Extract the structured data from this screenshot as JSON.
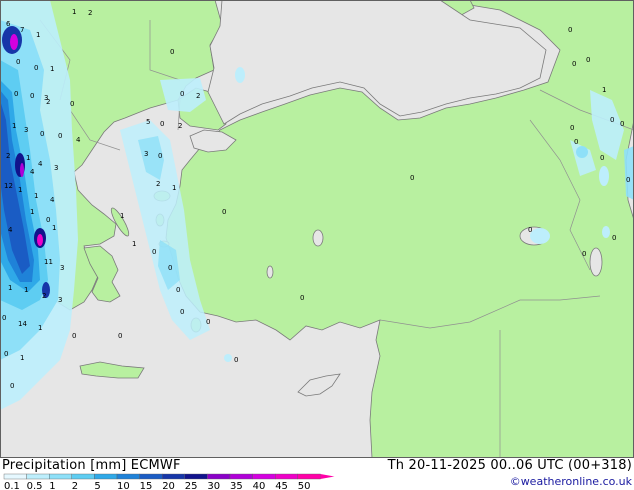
{
  "footer": {
    "title": "Precipitation [mm]  ECMWF",
    "datetime": "Th 20-11-2025 00..06 UTC (00+318)",
    "credit": "©weatheronline.co.uk"
  },
  "legend": {
    "labels": [
      "0.1",
      "0.5",
      "1",
      "2",
      "5",
      "10",
      "15",
      "20",
      "25",
      "30",
      "35",
      "40",
      "45",
      "50"
    ],
    "colors": [
      "#e6f8ff",
      "#bdeefc",
      "#8ee0f8",
      "#5ecdf2",
      "#2fa9e8",
      "#1f82d8",
      "#1a5cc4",
      "#1636a8",
      "#11138c",
      "#8a00c8",
      "#b000d8",
      "#d400e0",
      "#ee00c8",
      "#ff00a8"
    ]
  },
  "map": {
    "colors": {
      "sea": "#e6e6e6",
      "land": "#b8f0a0",
      "border": "#909090",
      "coast": "#7a7a7a"
    },
    "value_labels": [
      "1",
      "2",
      "6",
      "7",
      "1",
      "0",
      "0",
      "1",
      "0",
      "0",
      "3",
      "2",
      "0",
      "1",
      "3",
      "0",
      "0",
      "4",
      "2",
      "1",
      "4",
      "3",
      "4",
      "12",
      "1",
      "1",
      "4",
      "1",
      "0",
      "1",
      "4",
      "11",
      "3",
      "1",
      "1",
      "2",
      "3",
      "0",
      "14",
      "1",
      "0",
      "0",
      "1",
      "0",
      "0",
      "2",
      "5",
      "0",
      "2",
      "3",
      "0",
      "2",
      "1",
      "1",
      "1",
      "0",
      "0",
      "0",
      "0",
      "0",
      "0",
      "0",
      "0",
      "0",
      "0",
      "0",
      "0",
      "1",
      "0",
      "0",
      "0",
      "0",
      "0",
      "0",
      "0",
      "0",
      "0",
      "0",
      "0"
    ]
  }
}
